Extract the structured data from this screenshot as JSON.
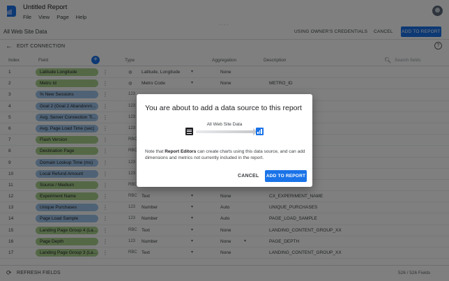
{
  "app": {
    "doc_title": "Untitled Report",
    "menu": [
      "File",
      "View",
      "Page",
      "Help"
    ],
    "brand_color": "#1a73e8"
  },
  "toolbar": {
    "data_source_name": "All Web Site Data",
    "credentials_label": "USING OWNER'S CREDENTIALS",
    "cancel_label": "CANCEL",
    "add_label": "ADD TO REPORT"
  },
  "edit_bar": {
    "label": "EDIT CONNECTION",
    "help_glyph": "?"
  },
  "table": {
    "headers": {
      "index": "Index",
      "field": "Field",
      "type": "Type",
      "aggregation": "Aggregation",
      "description": "Description"
    },
    "search_placeholder": "Search fields",
    "rows": [
      {
        "index": "1",
        "field": "Latitude Longitude",
        "kind": "dimension",
        "type_icon": "globe-icon",
        "type_glyph": "◍",
        "type": "Latitude, Longitude",
        "type_dd": true,
        "aggregation": "None",
        "agg_dd": false,
        "description": ""
      },
      {
        "index": "2",
        "field": "Metro Id",
        "kind": "dimension",
        "type_icon": "globe-icon",
        "type_glyph": "◍",
        "type": "Metro Code",
        "type_dd": true,
        "aggregation": "None",
        "agg_dd": false,
        "description": "METRO_ID"
      },
      {
        "index": "3",
        "field": "% New Sessions",
        "kind": "metric",
        "type_icon": "number-icon",
        "type_glyph": "123",
        "type": "",
        "type_dd": false,
        "aggregation": "",
        "agg_dd": false,
        "description": ""
      },
      {
        "index": "4",
        "field": "Goal 2 (Goal 2 Abandonm...",
        "kind": "metric",
        "type_icon": "number-icon",
        "type_glyph": "123",
        "type": "",
        "type_dd": false,
        "aggregation": "",
        "agg_dd": false,
        "description": ""
      },
      {
        "index": "5",
        "field": "Avg. Server Connection Ti...",
        "kind": "metric",
        "type_icon": "number-icon",
        "type_glyph": "123",
        "type": "",
        "type_dd": false,
        "aggregation": "",
        "agg_dd": false,
        "description": ""
      },
      {
        "index": "6",
        "field": "Avg. Page Load Time (sec)",
        "kind": "metric",
        "type_icon": "number-icon",
        "type_glyph": "123",
        "type": "",
        "type_dd": false,
        "aggregation": "",
        "agg_dd": false,
        "description": ""
      },
      {
        "index": "7",
        "field": "Flash Version",
        "kind": "dimension",
        "type_icon": "text-icon",
        "type_glyph": "RBC",
        "type": "",
        "type_dd": false,
        "aggregation": "",
        "agg_dd": false,
        "description": ""
      },
      {
        "index": "8",
        "field": "Destination Page",
        "kind": "dimension",
        "type_icon": "text-icon",
        "type_glyph": "RBC",
        "type": "",
        "type_dd": false,
        "aggregation": "",
        "agg_dd": false,
        "description": ""
      },
      {
        "index": "9",
        "field": "Domain Lookup Time (ms)",
        "kind": "metric",
        "type_icon": "number-icon",
        "type_glyph": "123",
        "type": "",
        "type_dd": false,
        "aggregation": "",
        "agg_dd": false,
        "description": ""
      },
      {
        "index": "10",
        "field": "Local Refund Amount",
        "kind": "metric",
        "type_icon": "number-icon",
        "type_glyph": "123",
        "type": "",
        "type_dd": false,
        "aggregation": "",
        "agg_dd": false,
        "description": ""
      },
      {
        "index": "11",
        "field": "Source / Medium",
        "kind": "dimension",
        "type_icon": "text-icon",
        "type_glyph": "RBC",
        "type": "",
        "type_dd": false,
        "aggregation": "",
        "agg_dd": false,
        "description": ""
      },
      {
        "index": "12",
        "field": "Experiment Name",
        "kind": "dimension",
        "type_icon": "text-icon",
        "type_glyph": "RBC",
        "type": "Text",
        "type_dd": true,
        "aggregation": "None",
        "agg_dd": false,
        "description": "CX_EXPERIMENT_NAME"
      },
      {
        "index": "13",
        "field": "Unique Purchases",
        "kind": "metric",
        "type_icon": "number-icon",
        "type_glyph": "123",
        "type": "Number",
        "type_dd": true,
        "aggregation": "Auto",
        "agg_dd": false,
        "description": "UNIQUE_PURCHASES"
      },
      {
        "index": "14",
        "field": "Page Load Sample",
        "kind": "metric",
        "type_icon": "number-icon",
        "type_glyph": "123",
        "type": "Number",
        "type_dd": true,
        "aggregation": "Auto",
        "agg_dd": false,
        "description": "PAGE_LOAD_SAMPLE"
      },
      {
        "index": "15",
        "field": "Landing Page Group 4 (La...",
        "kind": "dimension",
        "type_icon": "text-icon",
        "type_glyph": "RBC",
        "type": "Text",
        "type_dd": true,
        "aggregation": "None",
        "agg_dd": false,
        "description": "LANDING_CONTENT_GROUP_XX"
      },
      {
        "index": "16",
        "field": "Page Depth",
        "kind": "dimension",
        "type_icon": "number-icon",
        "type_glyph": "123",
        "type": "Number",
        "type_dd": true,
        "aggregation": "None",
        "agg_dd": true,
        "description": "PAGE_DEPTH"
      },
      {
        "index": "17",
        "field": "Landing Page Group 3 (La...",
        "kind": "dimension",
        "type_icon": "text-icon",
        "type_glyph": "RBC",
        "type": "Text",
        "type_dd": true,
        "aggregation": "None",
        "agg_dd": false,
        "description": "LANDING_CONTENT_GROUP_XX"
      }
    ]
  },
  "footer": {
    "refresh_label": "REFRESH FIELDS",
    "field_count": "526 / 526 Fields"
  },
  "dialog": {
    "title": "You are about to add a data source to this report",
    "data_source_name": "All Web Site Data",
    "note_before": "Note that ",
    "note_bold": "Report Editors",
    "note_after": " can create charts using this data source, and can add dimensions and metrics not currently included in the report.",
    "cancel_label": "CANCEL",
    "add_label": "ADD TO REPORT"
  }
}
